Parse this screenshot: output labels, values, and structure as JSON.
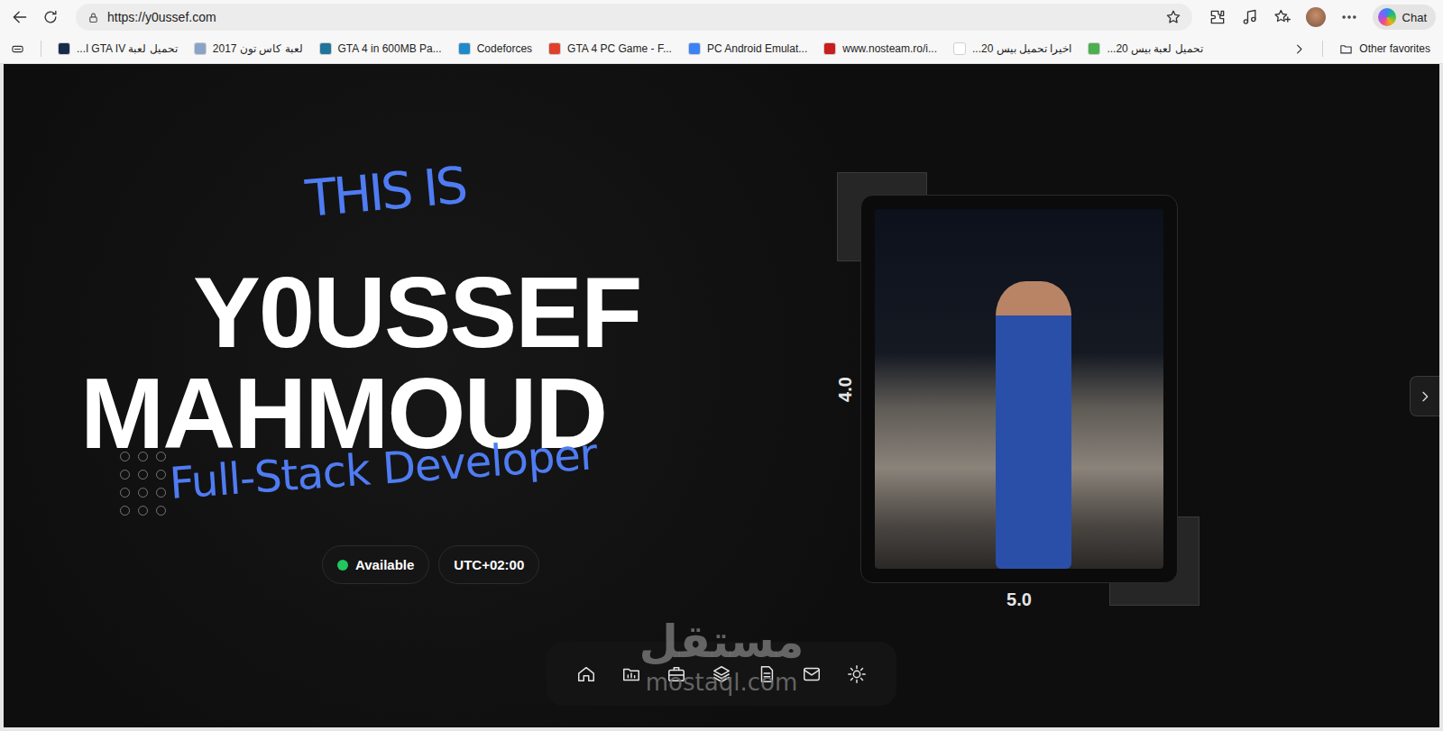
{
  "browser": {
    "url": "https://y0ussef.com",
    "chat_button": "Chat"
  },
  "bookmarks": [
    {
      "label": "تحميل لعبة GTA IV ا...",
      "color": "#1b2a4a"
    },
    {
      "label": "لعبة كاس تون 2017",
      "color": "#8aa4c8"
    },
    {
      "label": "GTA 4 in 600MB Pa...",
      "color": "#21759b"
    },
    {
      "label": "Codeforces",
      "color": "#1f8acb"
    },
    {
      "label": "GTA 4 PC Game - F...",
      "color": "#e0402b"
    },
    {
      "label": "PC Android Emulat...",
      "color": "#3b82f6"
    },
    {
      "label": "www.nosteam.ro/i...",
      "color": "#c81e1e"
    },
    {
      "label": "اخيرا تحميل بيس 20...",
      "color": "#ffffff"
    },
    {
      "label": "تحميل لعبة بيس 20...",
      "color": "#4caf50"
    }
  ],
  "other_favorites": "Other favorites",
  "hero": {
    "intro": "THIS IS",
    "name_lines": [
      "Y0USSEF",
      "MAHMOUD"
    ],
    "role": "Full-Stack Developer",
    "status": {
      "label": "Available",
      "online": true
    },
    "timezone": "UTC+02:00"
  },
  "photo": {
    "side_label": "4.0",
    "bottom_label": "5.0"
  },
  "dock": [
    {
      "kind": "home"
    },
    {
      "kind": "projects"
    },
    {
      "kind": "work"
    },
    {
      "kind": "stack"
    },
    {
      "kind": "resume"
    },
    {
      "kind": "contact"
    },
    {
      "kind": "theme"
    }
  ],
  "watermark": {
    "arabic": "مستقل",
    "latin": "mostaql.com"
  }
}
